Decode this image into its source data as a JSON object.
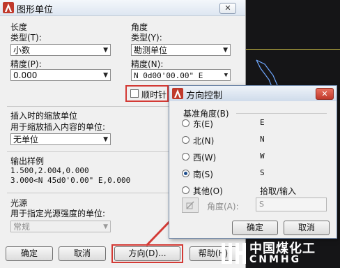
{
  "main_dialog": {
    "title": "图形单位",
    "close_label": "✕",
    "length": {
      "group_label": "长度",
      "type_label": "类型(T):",
      "type_value": "小数",
      "precision_label": "精度(P):",
      "precision_value": "0.000"
    },
    "angle": {
      "group_label": "角度",
      "type_label": "类型(Y):",
      "type_value": "勘测单位",
      "precision_label": "精度(N):",
      "precision_value": "N 0d00'00.00\" E",
      "clockwise_label": "顺时针"
    },
    "insert": {
      "group_label": "插入时的缩放单位",
      "desc": "用于缩放插入内容的单位:",
      "value": "无单位"
    },
    "sample": {
      "group_label": "输出样例",
      "line1": "1.500,2.004,0.000",
      "line2": "3.000<N 45d0'0.00\" E,0.000"
    },
    "light": {
      "group_label": "光源",
      "desc": "用于指定光源强度的单位:",
      "value": "常规"
    },
    "buttons": {
      "ok": "确定",
      "cancel": "取消",
      "direction": "方向(D)...",
      "help": "帮助(H)"
    }
  },
  "direction_dialog": {
    "title": "方向控制",
    "close_label": "✕",
    "base_angle_label": "基准角度(B)",
    "options": [
      {
        "label": "东(E)",
        "value": "E",
        "selected": false
      },
      {
        "label": "北(N)",
        "value": "N",
        "selected": false
      },
      {
        "label": "西(W)",
        "value": "W",
        "selected": false
      },
      {
        "label": "南(S)",
        "value": "S",
        "selected": true
      },
      {
        "label": "其他(O)",
        "value": "拾取/输入",
        "selected": false
      }
    ],
    "angle_label": "角度(A):",
    "angle_value": "S",
    "ok": "确定",
    "cancel": "取消"
  },
  "watermark": {
    "line1": "中国煤化工",
    "line2": "CNMHG"
  },
  "colors": {
    "highlight_red": "#d33a35",
    "app_icon_red": "#c0392b",
    "cad_line_yellow": "#d6c94a",
    "cad_shape_blue": "#6fa8ff"
  }
}
